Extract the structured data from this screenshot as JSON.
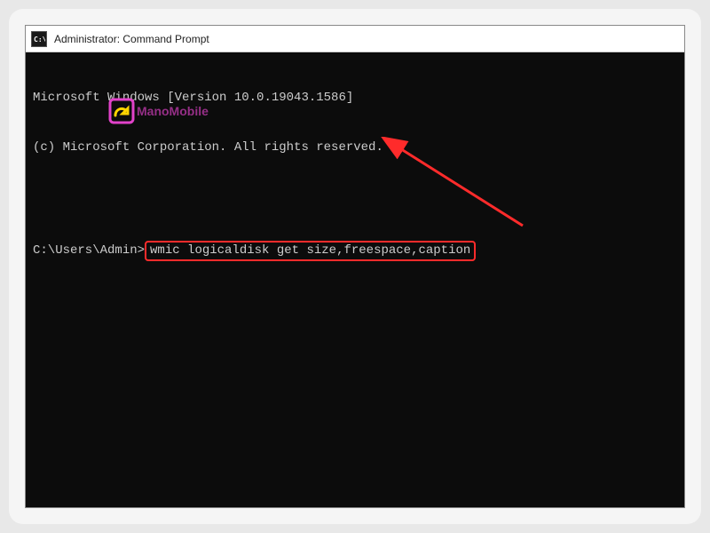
{
  "window": {
    "title": "Administrator: Command Prompt",
    "icon_label": "C:\\"
  },
  "terminal": {
    "line1": "Microsoft Windows [Version 10.0.19043.1586]",
    "line2": "(c) Microsoft Corporation. All rights reserved.",
    "prompt": "C:\\Users\\Admin>",
    "command": "wmic logicaldisk get size,freespace,caption"
  },
  "watermark": {
    "text": "ManoMobile"
  },
  "annotations": {
    "highlight_color": "#ff2b2b",
    "arrow_color": "#ff2b2b"
  }
}
